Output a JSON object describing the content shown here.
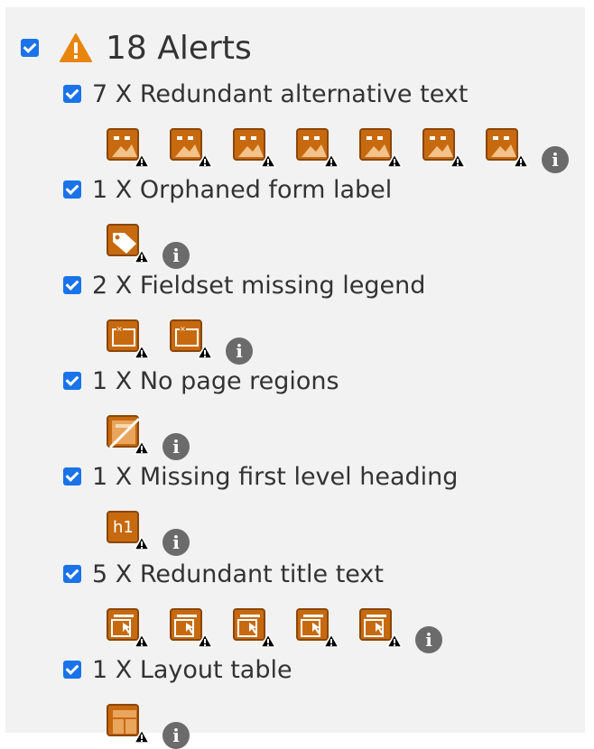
{
  "header": {
    "title": "18 Alerts"
  },
  "groups": [
    {
      "label": "7 X Redundant alternative text",
      "icon": "image-alt-icon",
      "count": 7
    },
    {
      "label": "1 X Orphaned form label",
      "icon": "tag-label-icon",
      "count": 1
    },
    {
      "label": "2 X Fieldset missing legend",
      "icon": "fieldset-icon",
      "count": 2
    },
    {
      "label": "1 X No page regions",
      "icon": "page-regions-icon",
      "count": 1
    },
    {
      "label": "1 X Missing first level heading",
      "icon": "h1-icon",
      "count": 1,
      "icon_text": "h1"
    },
    {
      "label": "5 X Redundant title text",
      "icon": "title-text-icon",
      "count": 5
    },
    {
      "label": "1 X Layout table",
      "icon": "layout-table-icon",
      "count": 1
    }
  ],
  "colors": {
    "checkbox": "#1a73e8",
    "alert_orange": "#c76a0f",
    "warning_header": "#e8850c",
    "info_gray": "#6b6b6b"
  }
}
